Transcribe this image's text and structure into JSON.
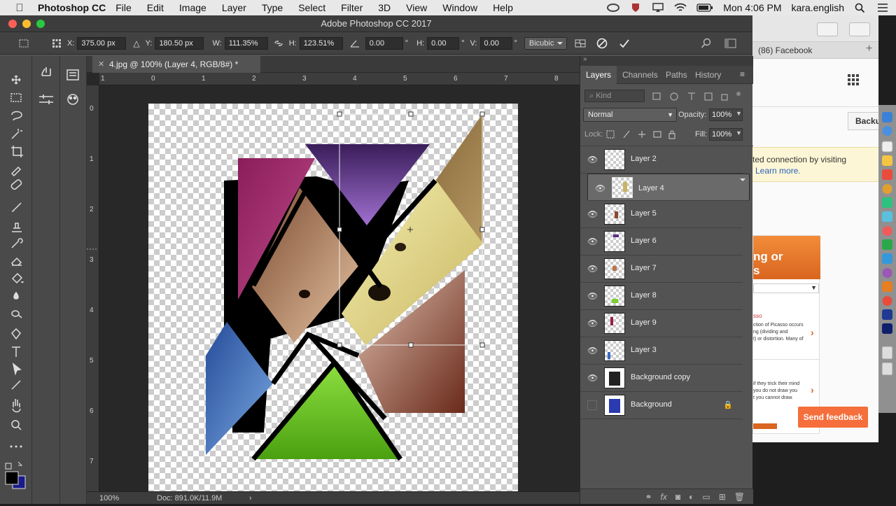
{
  "menubar": {
    "app_name": "Photoshop CC",
    "items": [
      "File",
      "Edit",
      "Image",
      "Layer",
      "Type",
      "Select",
      "Filter",
      "3D",
      "View",
      "Window",
      "Help"
    ],
    "clock": "Mon 4:06 PM",
    "user": "kara.english"
  },
  "window": {
    "title": "Adobe Photoshop CC 2017"
  },
  "options": {
    "x_label": "X:",
    "x_value": "375.00 px",
    "y_label": "Y:",
    "y_value": "180.50 px",
    "w_label": "W:",
    "w_value": "111.35%",
    "h_label": "H:",
    "h_value": "123.51%",
    "angle_value": "0.00",
    "deg": "°",
    "hskew_label": "H:",
    "hskew_value": "0.00",
    "vskew_label": "V:",
    "vskew_value": "0.00",
    "interpolation": "Bicubic"
  },
  "document": {
    "tab_title": "4.jpg @ 100% (Layer 4, RGB/8#) *",
    "ruler_h": [
      "1",
      "0",
      "1",
      "2",
      "3",
      "4",
      "5",
      "6",
      "7",
      "8"
    ],
    "ruler_v": [
      "0",
      "1",
      "2",
      "3",
      "4",
      "5",
      "6",
      "7"
    ],
    "zoom": "100%",
    "doc_info": "Doc: 891.0K/11.9M"
  },
  "panel": {
    "tabs": [
      "Layers",
      "Channels",
      "Paths",
      "History"
    ],
    "kind_placeholder": "Kind",
    "blend_mode": "Normal",
    "opacity_label": "Opacity:",
    "opacity_value": "100%",
    "lock_label": "Lock:",
    "fill_label": "Fill:",
    "fill_value": "100%",
    "layers": [
      {
        "name": "Layer 2"
      },
      {
        "name": "Layer 4"
      },
      {
        "name": "Layer 5"
      },
      {
        "name": "Layer 6"
      },
      {
        "name": "Layer 7"
      },
      {
        "name": "Layer 8"
      },
      {
        "name": "Layer 9"
      },
      {
        "name": "Layer 3"
      },
      {
        "name": "Background copy"
      },
      {
        "name": "Background"
      }
    ]
  },
  "browser": {
    "tab_title": "(86) Facebook",
    "backup_button": "Backu",
    "notice_line1": "ted connection by visiting",
    "notice_link": "Learn more.",
    "card_title_1": "ng or",
    "card_title_2": "s",
    "card_text_1": "sso",
    "card_text_2": "ction of Picasso occurs",
    "card_text_3": "ng (dividing and",
    "card_text_4": "t) or distortion.   Many of",
    "card_text_5": "if they trick their mind",
    "card_text_6": "you do not draw you",
    "card_text_7": "t you cannot draw.",
    "feedback": "Send feedback"
  },
  "colors": {
    "accent": "#f56e3b",
    "ps_bg": "#535353",
    "canvas_bg": "#282828"
  }
}
